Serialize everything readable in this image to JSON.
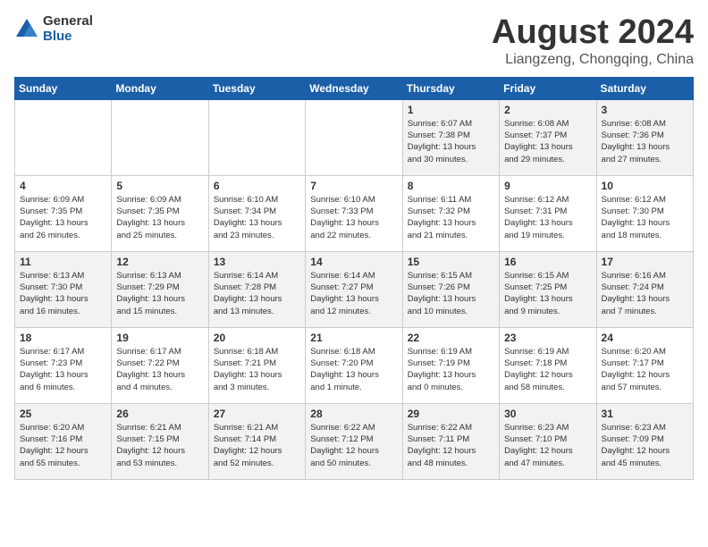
{
  "logo": {
    "general": "General",
    "blue": "Blue"
  },
  "title": {
    "month_year": "August 2024",
    "location": "Liangzeng, Chongqing, China"
  },
  "weekdays": [
    "Sunday",
    "Monday",
    "Tuesday",
    "Wednesday",
    "Thursday",
    "Friday",
    "Saturday"
  ],
  "weeks": [
    [
      {
        "day": "",
        "info": ""
      },
      {
        "day": "",
        "info": ""
      },
      {
        "day": "",
        "info": ""
      },
      {
        "day": "",
        "info": ""
      },
      {
        "day": "1",
        "info": "Sunrise: 6:07 AM\nSunset: 7:38 PM\nDaylight: 13 hours\nand 30 minutes."
      },
      {
        "day": "2",
        "info": "Sunrise: 6:08 AM\nSunset: 7:37 PM\nDaylight: 13 hours\nand 29 minutes."
      },
      {
        "day": "3",
        "info": "Sunrise: 6:08 AM\nSunset: 7:36 PM\nDaylight: 13 hours\nand 27 minutes."
      }
    ],
    [
      {
        "day": "4",
        "info": "Sunrise: 6:09 AM\nSunset: 7:35 PM\nDaylight: 13 hours\nand 26 minutes."
      },
      {
        "day": "5",
        "info": "Sunrise: 6:09 AM\nSunset: 7:35 PM\nDaylight: 13 hours\nand 25 minutes."
      },
      {
        "day": "6",
        "info": "Sunrise: 6:10 AM\nSunset: 7:34 PM\nDaylight: 13 hours\nand 23 minutes."
      },
      {
        "day": "7",
        "info": "Sunrise: 6:10 AM\nSunset: 7:33 PM\nDaylight: 13 hours\nand 22 minutes."
      },
      {
        "day": "8",
        "info": "Sunrise: 6:11 AM\nSunset: 7:32 PM\nDaylight: 13 hours\nand 21 minutes."
      },
      {
        "day": "9",
        "info": "Sunrise: 6:12 AM\nSunset: 7:31 PM\nDaylight: 13 hours\nand 19 minutes."
      },
      {
        "day": "10",
        "info": "Sunrise: 6:12 AM\nSunset: 7:30 PM\nDaylight: 13 hours\nand 18 minutes."
      }
    ],
    [
      {
        "day": "11",
        "info": "Sunrise: 6:13 AM\nSunset: 7:30 PM\nDaylight: 13 hours\nand 16 minutes."
      },
      {
        "day": "12",
        "info": "Sunrise: 6:13 AM\nSunset: 7:29 PM\nDaylight: 13 hours\nand 15 minutes."
      },
      {
        "day": "13",
        "info": "Sunrise: 6:14 AM\nSunset: 7:28 PM\nDaylight: 13 hours\nand 13 minutes."
      },
      {
        "day": "14",
        "info": "Sunrise: 6:14 AM\nSunset: 7:27 PM\nDaylight: 13 hours\nand 12 minutes."
      },
      {
        "day": "15",
        "info": "Sunrise: 6:15 AM\nSunset: 7:26 PM\nDaylight: 13 hours\nand 10 minutes."
      },
      {
        "day": "16",
        "info": "Sunrise: 6:15 AM\nSunset: 7:25 PM\nDaylight: 13 hours\nand 9 minutes."
      },
      {
        "day": "17",
        "info": "Sunrise: 6:16 AM\nSunset: 7:24 PM\nDaylight: 13 hours\nand 7 minutes."
      }
    ],
    [
      {
        "day": "18",
        "info": "Sunrise: 6:17 AM\nSunset: 7:23 PM\nDaylight: 13 hours\nand 6 minutes."
      },
      {
        "day": "19",
        "info": "Sunrise: 6:17 AM\nSunset: 7:22 PM\nDaylight: 13 hours\nand 4 minutes."
      },
      {
        "day": "20",
        "info": "Sunrise: 6:18 AM\nSunset: 7:21 PM\nDaylight: 13 hours\nand 3 minutes."
      },
      {
        "day": "21",
        "info": "Sunrise: 6:18 AM\nSunset: 7:20 PM\nDaylight: 13 hours\nand 1 minute."
      },
      {
        "day": "22",
        "info": "Sunrise: 6:19 AM\nSunset: 7:19 PM\nDaylight: 13 hours\nand 0 minutes."
      },
      {
        "day": "23",
        "info": "Sunrise: 6:19 AM\nSunset: 7:18 PM\nDaylight: 12 hours\nand 58 minutes."
      },
      {
        "day": "24",
        "info": "Sunrise: 6:20 AM\nSunset: 7:17 PM\nDaylight: 12 hours\nand 57 minutes."
      }
    ],
    [
      {
        "day": "25",
        "info": "Sunrise: 6:20 AM\nSunset: 7:16 PM\nDaylight: 12 hours\nand 55 minutes."
      },
      {
        "day": "26",
        "info": "Sunrise: 6:21 AM\nSunset: 7:15 PM\nDaylight: 12 hours\nand 53 minutes."
      },
      {
        "day": "27",
        "info": "Sunrise: 6:21 AM\nSunset: 7:14 PM\nDaylight: 12 hours\nand 52 minutes."
      },
      {
        "day": "28",
        "info": "Sunrise: 6:22 AM\nSunset: 7:12 PM\nDaylight: 12 hours\nand 50 minutes."
      },
      {
        "day": "29",
        "info": "Sunrise: 6:22 AM\nSunset: 7:11 PM\nDaylight: 12 hours\nand 48 minutes."
      },
      {
        "day": "30",
        "info": "Sunrise: 6:23 AM\nSunset: 7:10 PM\nDaylight: 12 hours\nand 47 minutes."
      },
      {
        "day": "31",
        "info": "Sunrise: 6:23 AM\nSunset: 7:09 PM\nDaylight: 12 hours\nand 45 minutes."
      }
    ]
  ]
}
